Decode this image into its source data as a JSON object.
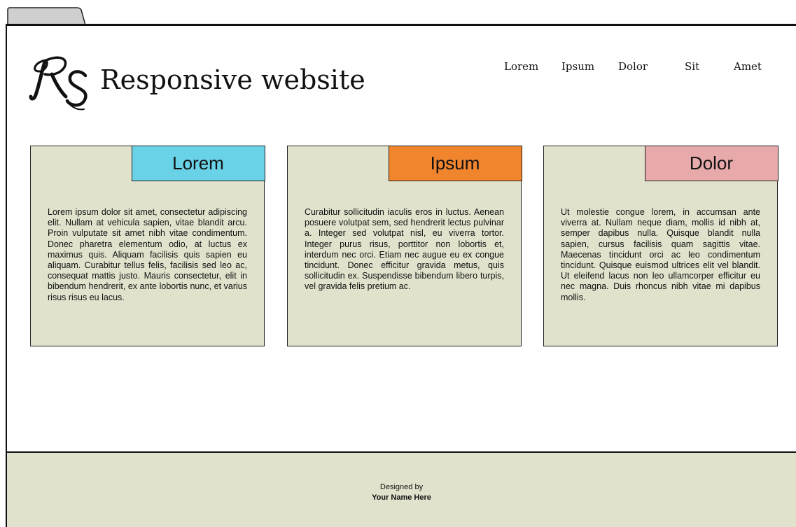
{
  "header": {
    "logo_text": "RS",
    "title": "Responsive website"
  },
  "nav": {
    "items": [
      {
        "label": "Lorem"
      },
      {
        "label": "Ipsum"
      },
      {
        "label": "Dolor"
      },
      {
        "label": "Sit"
      },
      {
        "label": "Amet"
      }
    ]
  },
  "cards": [
    {
      "label": "Lorem",
      "accent_color": "#6ad2e6",
      "text": "Lorem ipsum dolor sit amet, consectetur adipiscing elit. Nullam at vehicula sapien, vitae blandit arcu. Proin vulputate sit amet nibh vitae condimentum. Donec pharetra elementum odio, at luctus ex maximus quis. Aliquam facilisis quis sapien eu aliquam. Curabitur tellus felis, facilisis sed leo ac, consequat mattis justo. Mauris consectetur, elit in bibendum hendrerit, ex ante lobortis nunc, et varius risus risus eu lacus."
    },
    {
      "label": "Ipsum",
      "accent_color": "#f0852e",
      "text": "Curabitur sollicitudin iaculis eros in luctus. Aenean posuere volutpat sem, sed hendrerit lectus pulvinar a. Integer sed volutpat nisl, eu viverra tortor. Integer purus risus, porttitor non lobortis et, interdum nec orci. Etiam nec augue eu ex congue tincidunt. Donec efficitur gravida metus, quis sollicitudin ex. Suspendisse bibendum libero turpis, vel gravida felis pretium ac."
    },
    {
      "label": "Dolor",
      "accent_color": "#e8a9ab",
      "text": "Ut molestie congue lorem, in accumsan ante viverra at. Nullam neque diam, mollis id nibh at, semper dapibus nulla. Quisque blandit nulla sapien, cursus facilisis quam sagittis vitae. Maecenas tincidunt orci ac leo condimentum tincidunt. Quisque euismod ultrices elit vel blandit. Ut eleifend lacus non leo ullamcorper efficitur eu nec magna. Duis rhoncus nibh vitae mi dapibus mollis."
    }
  ],
  "footer": {
    "designed_by": "Designed by",
    "name": "Your Name Here"
  },
  "colors": {
    "card_background": "#e0e2cc",
    "footer_background": "#e0e2cc",
    "browser_tab": "#cfcfcf"
  }
}
